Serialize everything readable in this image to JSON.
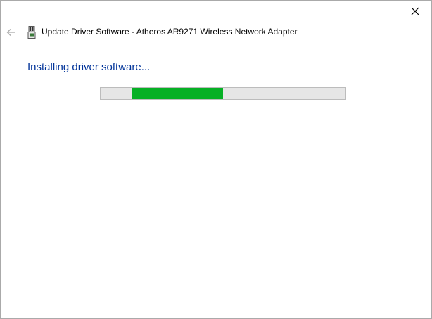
{
  "dialog": {
    "wizard_title": "Update Driver Software - Atheros AR9271 Wireless Network Adapter",
    "main_instruction": "Installing driver software...",
    "progress": {
      "state": "indeterminate",
      "chunk_start_fraction": 0.13,
      "chunk_end_fraction": 0.5,
      "fill_color": "#06b025",
      "track_color": "#e6e6e6"
    },
    "icons": {
      "back": "arrow-left-icon",
      "device": "network-adapter-icon",
      "close": "close-icon"
    },
    "colors": {
      "instruction_text": "#003399",
      "disabled_arrow": "#aaaaaa"
    }
  }
}
